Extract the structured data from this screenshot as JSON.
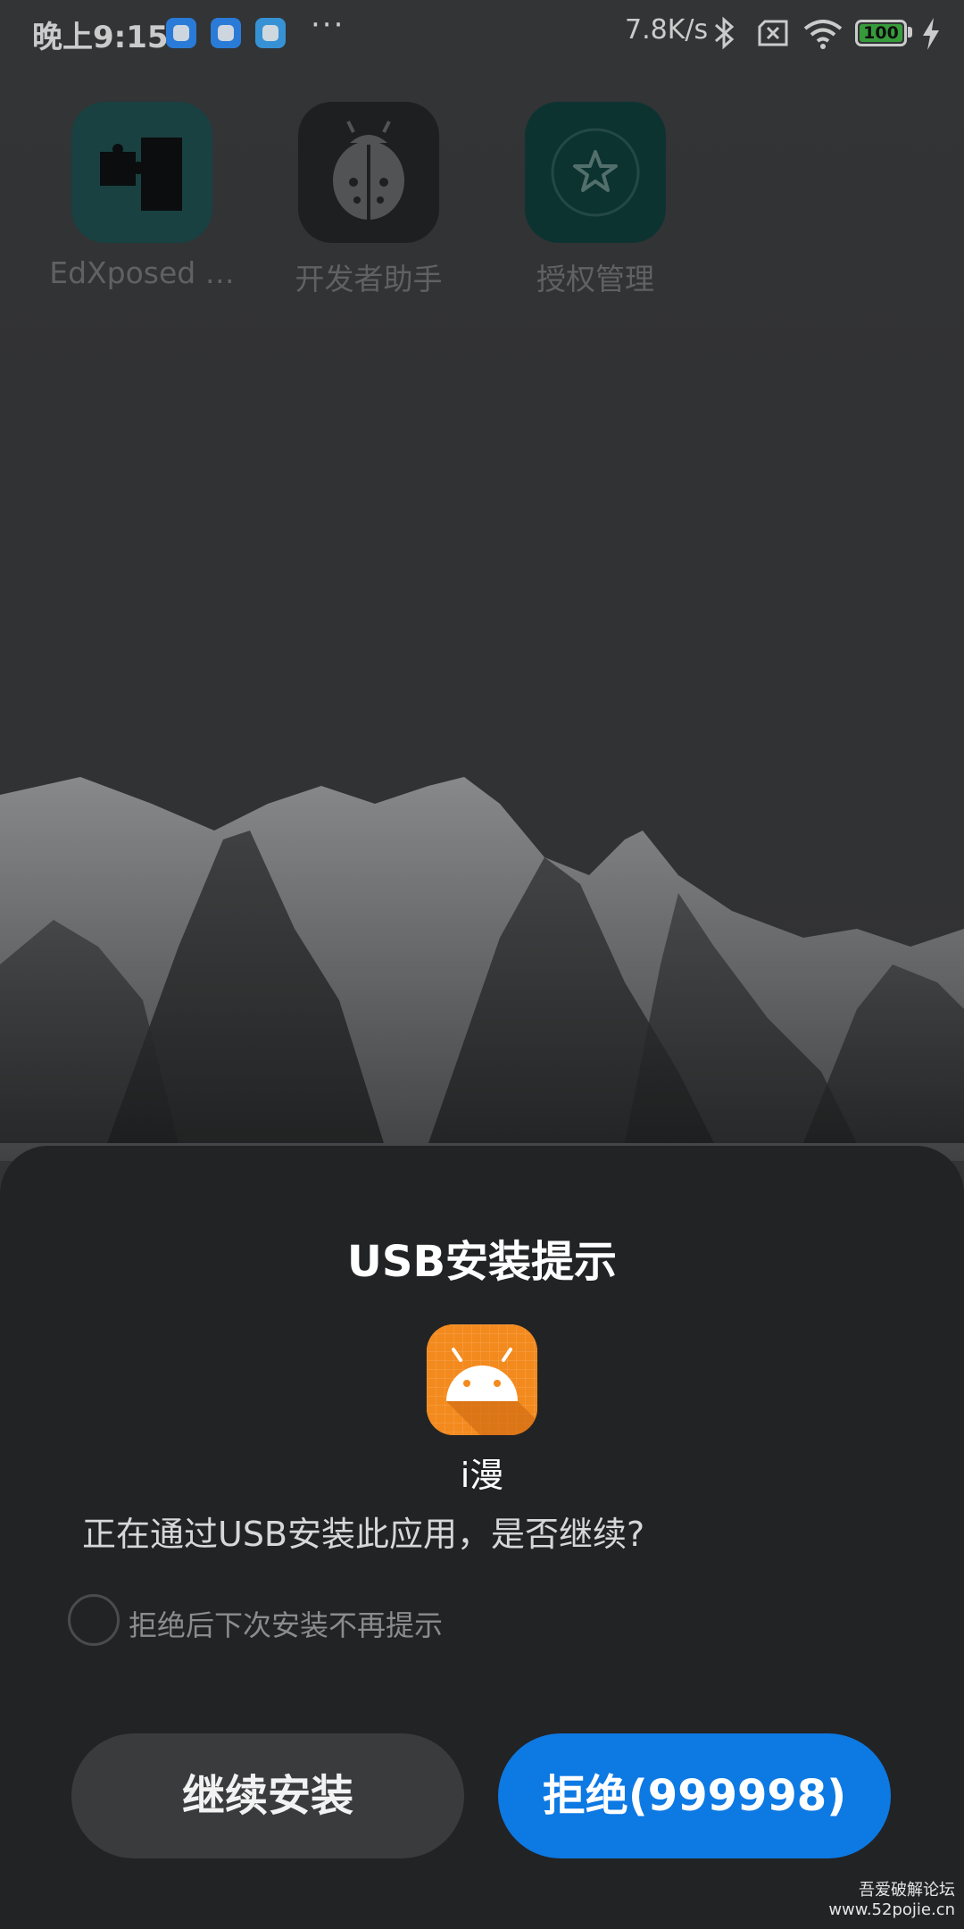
{
  "status_bar": {
    "time": "晚上9:15",
    "more": "···",
    "net_speed": "7.8K/s",
    "battery_level": "100",
    "icons": [
      "app-notification-icon",
      "app-notification-icon",
      "weather-icon",
      "bluetooth-icon",
      "no-sim-icon",
      "wifi-icon",
      "battery-icon",
      "charging-icon"
    ]
  },
  "home": {
    "apps": [
      {
        "label": "EdXposed …",
        "icon": "puzzle-icon"
      },
      {
        "label": "开发者助手",
        "icon": "ladybug-icon"
      },
      {
        "label": "授权管理",
        "icon": "star-icon"
      }
    ]
  },
  "dialog": {
    "title": "USB安装提示",
    "app_name": "i漫",
    "app_icon": "android-icon",
    "message": "正在通过USB安装此应用，是否继续?",
    "checkbox_label": "拒绝后下次安装不再提示",
    "continue_button": "继续安装",
    "reject_button": "拒绝(999998)"
  },
  "watermark": {
    "line1": "吾爱破解论坛",
    "line2": "www.52pojie.cn"
  },
  "colors": {
    "sheet_bg": "#222325",
    "reject_button": "#0d79e3",
    "continue_button": "#3a3b3d",
    "app_icon_bg": "#f38a1e",
    "battery_fill": "#3fb144"
  }
}
